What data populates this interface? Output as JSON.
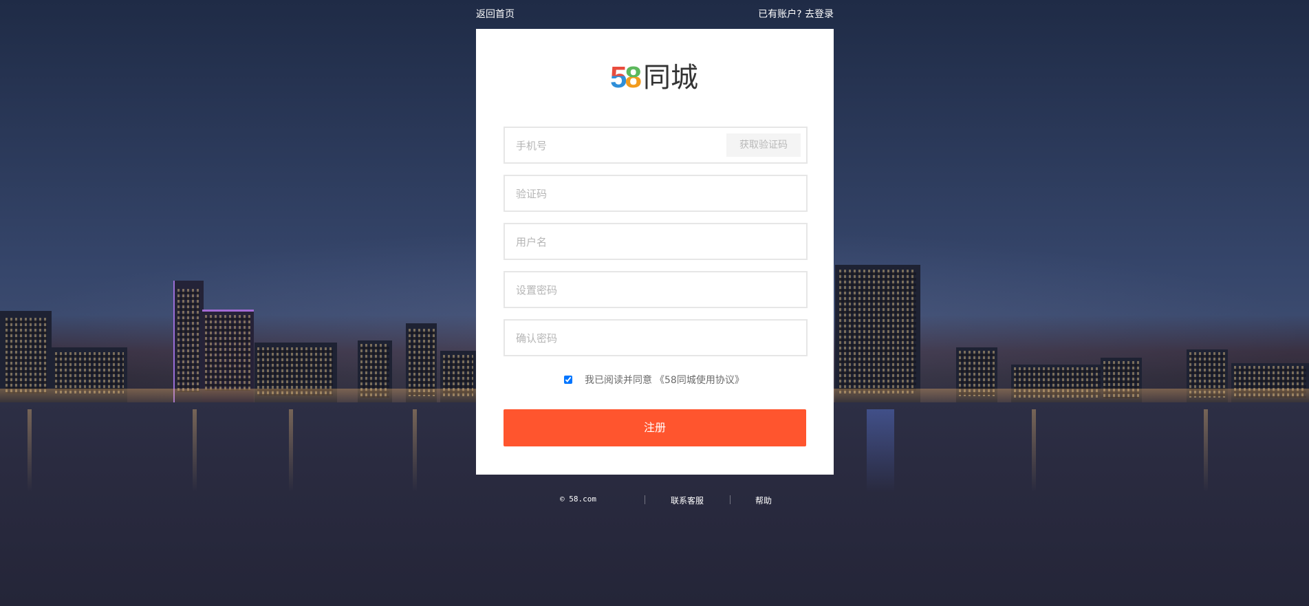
{
  "header": {
    "back_home": "返回首页",
    "login_prompt": "已有账户? 去登录"
  },
  "logo": {
    "digit_5": "5",
    "digit_8": "8",
    "brand": "同城",
    "colors": {
      "red": "#e94c3d",
      "blue": "#2f8fd9",
      "green": "#5cb85c",
      "orange": "#f29b1d",
      "text": "#333333"
    }
  },
  "form": {
    "phone_placeholder": "手机号",
    "get_code_label": "获取验证码",
    "code_placeholder": "验证码",
    "username_placeholder": "用户名",
    "password_placeholder": "设置密码",
    "confirm_placeholder": "确认密码",
    "agree_checked": true,
    "agree_text": "我已阅读并同意",
    "protocol_text": "《58同城使用协议》",
    "submit_label": "注册"
  },
  "footer": {
    "copyright": "© 58.com",
    "contact": "联系客服",
    "help": "帮助"
  },
  "colors": {
    "accent": "#ff552e",
    "field_border": "#e6e6e6",
    "placeholder": "#b5b5b5"
  }
}
